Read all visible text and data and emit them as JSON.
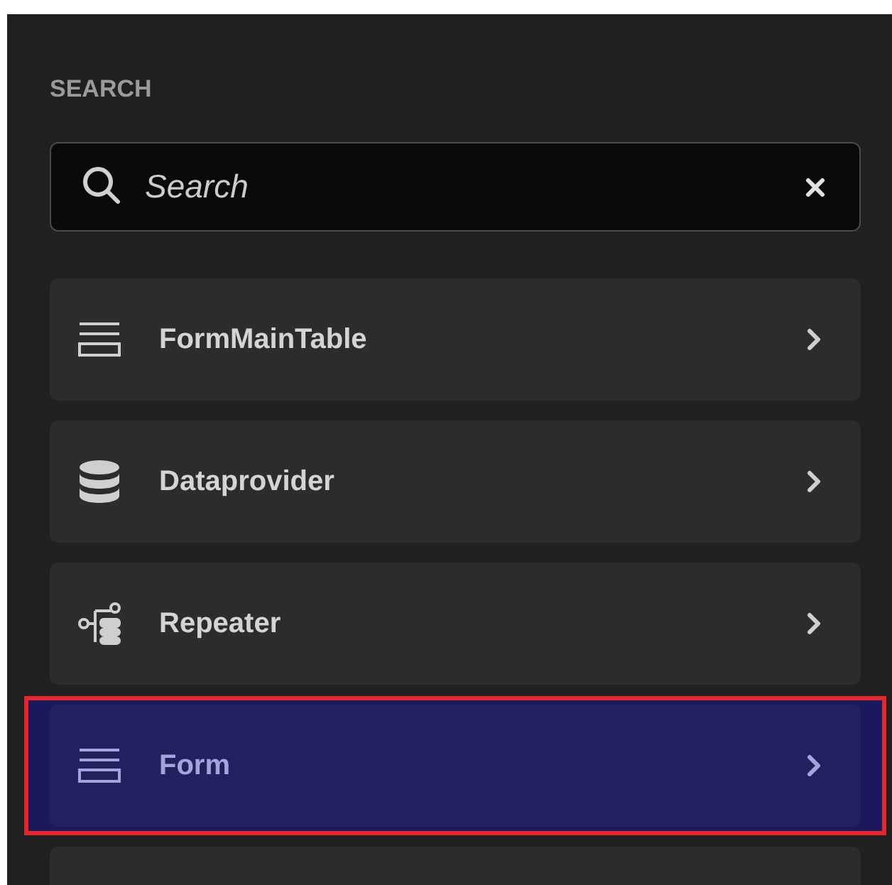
{
  "section_title": "SEARCH",
  "search": {
    "placeholder": "Search"
  },
  "items": [
    {
      "kind": "table",
      "label": "FormMainTable",
      "selected": false
    },
    {
      "kind": "database",
      "label": "Dataprovider",
      "selected": false
    },
    {
      "kind": "repeater",
      "label": "Repeater",
      "selected": false
    },
    {
      "kind": "form",
      "label": "Form",
      "selected": true
    }
  ]
}
